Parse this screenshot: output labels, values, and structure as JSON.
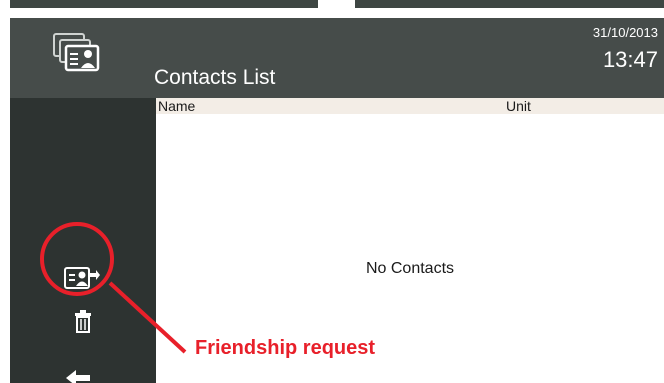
{
  "header": {
    "title": "Contacts List",
    "date": "31/10/2013",
    "time": "13:47"
  },
  "table": {
    "columns": [
      "Name",
      "Unit"
    ],
    "empty_message": "No Contacts"
  },
  "sidebar": {
    "icons": [
      "friend-request-icon",
      "trash-icon",
      "back-arrow-icon"
    ]
  },
  "annotation": {
    "label": "Friendship request",
    "color": "#e8202a"
  },
  "colors": {
    "header_bg": "#464c4a",
    "sidebar_bg": "#2d3331",
    "table_header_bg": "#f3ede6"
  }
}
